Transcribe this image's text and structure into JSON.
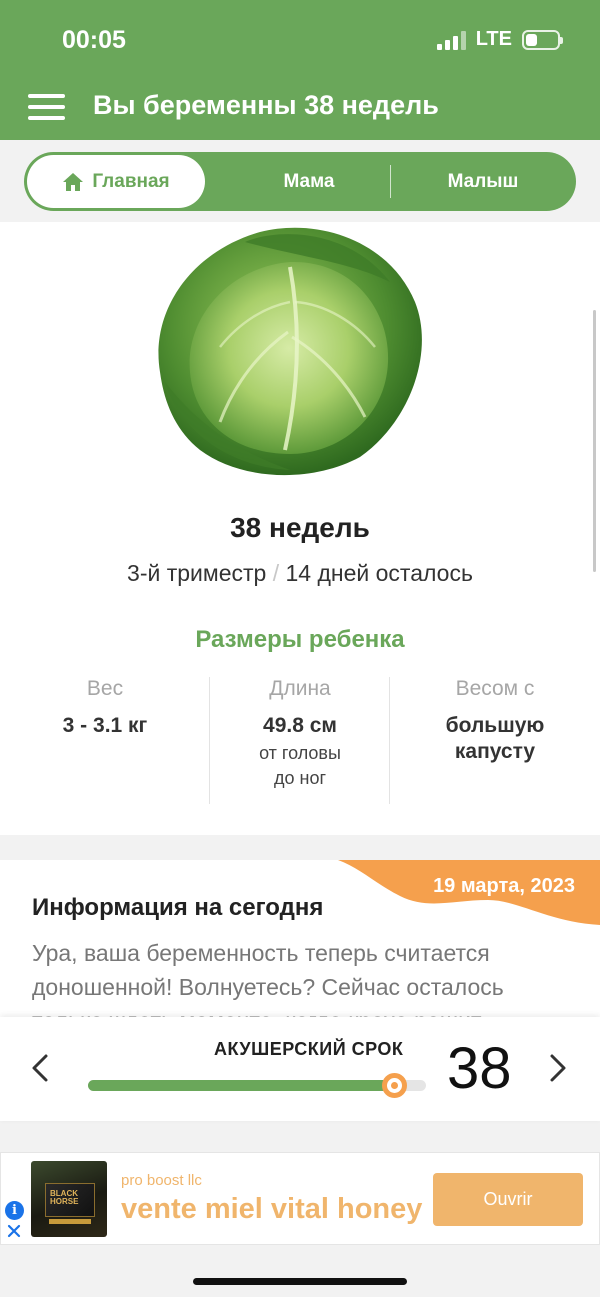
{
  "status_bar": {
    "time": "00:05",
    "network": "LTE",
    "battery_percent": 35
  },
  "app_bar": {
    "title": "Вы беременны 38 недель"
  },
  "tabs": {
    "home": "Главная",
    "mama": "Мама",
    "baby": "Малыш",
    "selected": "home"
  },
  "summary": {
    "image_icon": "cabbage",
    "week_title": "38 недель",
    "trimester": "3-й триместр",
    "separator": "/",
    "days_left": "14 дней осталось"
  },
  "baby_sizes": {
    "heading": "Размеры ребенка",
    "weight_label": "Вес",
    "weight_value": "3 - 3.1 кг",
    "length_label": "Длина",
    "length_value": "49.8 см",
    "length_note_1": "от головы",
    "length_note_2": "до ног",
    "compare_label": "Весом с",
    "compare_value_1": "большую",
    "compare_value_2": "капусту"
  },
  "today_info": {
    "date": "19 марта, 2023",
    "title": "Информация на сегодня",
    "text": "Ура, ваша беременность теперь считается доношенной! Волнуетесь? Сейчас осталось только ждать момента, когда кроха решит"
  },
  "week_slider": {
    "label": "АКУШЕРСКИЙ СРОК",
    "week": "38",
    "position_fraction": 0.905
  },
  "ad": {
    "advertiser": "pro boost llc",
    "headline": "vente miel vital honey",
    "cta": "Ouvrir",
    "image_text": "BLACK HORSE"
  },
  "colors": {
    "brand_green": "#6aa75a",
    "accent_orange": "#f5a04d",
    "ad_gold": "#f0b56c"
  }
}
